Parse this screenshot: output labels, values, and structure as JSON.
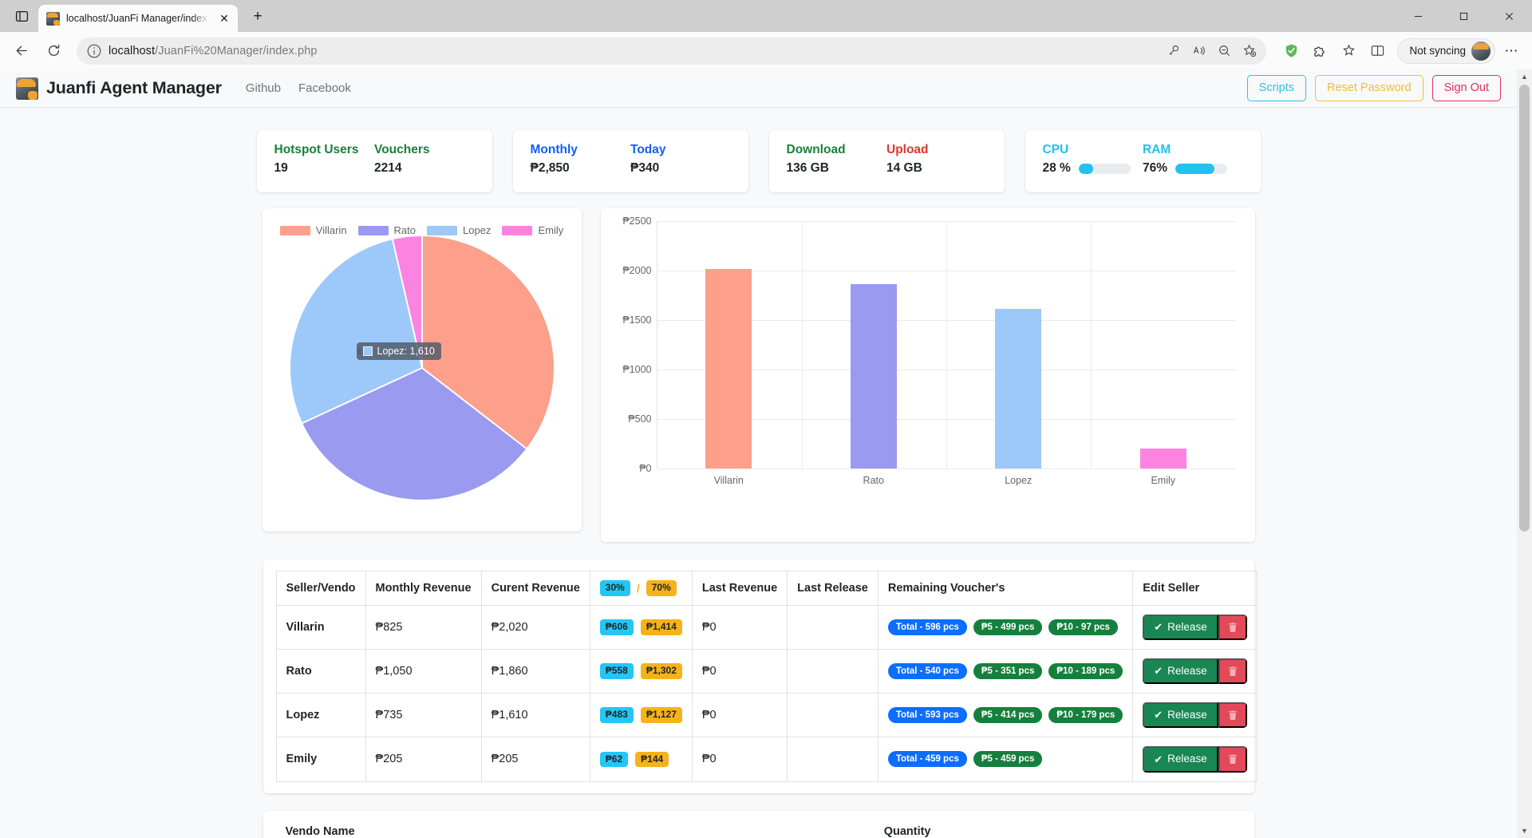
{
  "browser": {
    "tab_title": "localhost/JuanFi Manager/index.",
    "new_tab_label": "+",
    "close_label": "✕",
    "url_prefix": "localhost",
    "url_rest": "/JuanFi%20Manager/index.php",
    "profile_label": "Not syncing",
    "menu_label": "⋯",
    "icons": {
      "tab_list": "tab-list-icon",
      "back": "back-arrow-icon",
      "reload": "reload-icon",
      "info": "site-info-icon",
      "password": "key-icon",
      "read_aloud": "read-aloud-icon",
      "zoom_out": "zoom-out-icon",
      "favorite": "add-favorite-icon",
      "adblock": "shield-check-icon",
      "extensions": "extensions-puzzle-icon",
      "collections": "collections-icon",
      "split": "split-screen-icon"
    }
  },
  "appbar": {
    "brand": "Juanfi Agent Manager",
    "links": [
      "Github",
      "Facebook"
    ],
    "actions": [
      {
        "label": "Scripts",
        "style": "scripts"
      },
      {
        "label": "Reset Password",
        "style": "reset"
      },
      {
        "label": "Sign Out",
        "style": "signout"
      }
    ]
  },
  "stats": [
    {
      "name": "users-vouchers",
      "items": [
        {
          "label": "Hotspot Users",
          "value": "19",
          "color": "#1a7f3c"
        },
        {
          "label": "Vouchers",
          "value": "2214",
          "color": "#1a7f3c"
        }
      ]
    },
    {
      "name": "revenue",
      "items": [
        {
          "label": "Monthly",
          "value": "₱2,850",
          "color": "#1060f5"
        },
        {
          "label": "Today",
          "value": "₱340",
          "color": "#1060f5"
        }
      ]
    },
    {
      "name": "traffic",
      "items": [
        {
          "label": "Download",
          "value": "136 GB",
          "color": "#1a7f3c"
        },
        {
          "label": "Upload",
          "value": "14 GB",
          "color": "#e4332f"
        }
      ]
    }
  ],
  "system": {
    "cpu": {
      "label": "CPU",
      "value": "28 %",
      "percent": 28,
      "color": "#23c0f0"
    },
    "ram": {
      "label": "RAM",
      "value": "76%",
      "percent": 76,
      "color": "#23c0f0"
    }
  },
  "chart_data": [
    {
      "type": "pie",
      "title": "",
      "labels": [
        "Villarin",
        "Rato",
        "Lopez",
        "Emily"
      ],
      "values": [
        2020,
        1860,
        1610,
        205
      ],
      "colors": [
        "#fca08b",
        "#9a9af0",
        "#9dc8fa",
        "#fd83e0"
      ],
      "legend_position": "top",
      "tooltip": {
        "label": "Lopez",
        "value": "1,610",
        "text": "Lopez: 1,610"
      }
    },
    {
      "type": "bar",
      "title": "",
      "categories": [
        "Villarin",
        "Rato",
        "Lopez",
        "Emily"
      ],
      "values": [
        2020,
        1860,
        1610,
        205
      ],
      "colors": [
        "#fca08b",
        "#9a9af0",
        "#9dc8fa",
        "#fd83e0"
      ],
      "ylabel": "",
      "xlabel": "",
      "ylim": [
        0,
        2500
      ],
      "yticks": [
        "₱0",
        "₱500",
        "₱1000",
        "₱1500",
        "₱2000",
        "₱2500"
      ],
      "ytick_values": [
        0,
        500,
        1000,
        1500,
        2000,
        2500
      ],
      "grid": true,
      "legend_position": "none"
    }
  ],
  "seller_table": {
    "headers": [
      "Seller/Vendo",
      "Monthly Revenue",
      "Curent Revenue",
      "",
      "Last Revenue",
      "Last Release",
      "Remaining Voucher's",
      "Edit Seller"
    ],
    "split_header": {
      "left": "30%",
      "sep": "/",
      "right": "70%"
    },
    "rows": [
      {
        "name": "Villarin",
        "monthly": "₱825",
        "current": "₱2,020",
        "share_low": "₱606",
        "share_high": "₱1,414",
        "last_revenue": "₱0",
        "last_release": "",
        "vouchers": [
          {
            "text": "Total - 596 pcs",
            "style": "blue"
          },
          {
            "text": "₱5 - 499 pcs",
            "style": "green"
          },
          {
            "text": "₱10 - 97 pcs",
            "style": "green"
          }
        ],
        "action": "Release"
      },
      {
        "name": "Rato",
        "monthly": "₱1,050",
        "current": "₱1,860",
        "share_low": "₱558",
        "share_high": "₱1,302",
        "last_revenue": "₱0",
        "last_release": "",
        "vouchers": [
          {
            "text": "Total - 540 pcs",
            "style": "blue"
          },
          {
            "text": "₱5 - 351 pcs",
            "style": "green"
          },
          {
            "text": "₱10 - 189 pcs",
            "style": "green"
          }
        ],
        "action": "Release"
      },
      {
        "name": "Lopez",
        "monthly": "₱735",
        "current": "₱1,610",
        "share_low": "₱483",
        "share_high": "₱1,127",
        "last_revenue": "₱0",
        "last_release": "",
        "vouchers": [
          {
            "text": "Total - 593 pcs",
            "style": "blue"
          },
          {
            "text": "₱5 - 414 pcs",
            "style": "green"
          },
          {
            "text": "₱10 - 179 pcs",
            "style": "green"
          }
        ],
        "action": "Release"
      },
      {
        "name": "Emily",
        "monthly": "₱205",
        "current": "₱205",
        "share_low": "₱62",
        "share_high": "₱144",
        "last_revenue": "₱0",
        "last_release": "",
        "vouchers": [
          {
            "text": "Total - 459 pcs",
            "style": "blue"
          },
          {
            "text": "₱5 - 459 pcs",
            "style": "green"
          }
        ],
        "action": "Release"
      }
    ]
  },
  "vendo_table": {
    "headers": [
      "Vendo Name",
      "Quantity"
    ]
  }
}
